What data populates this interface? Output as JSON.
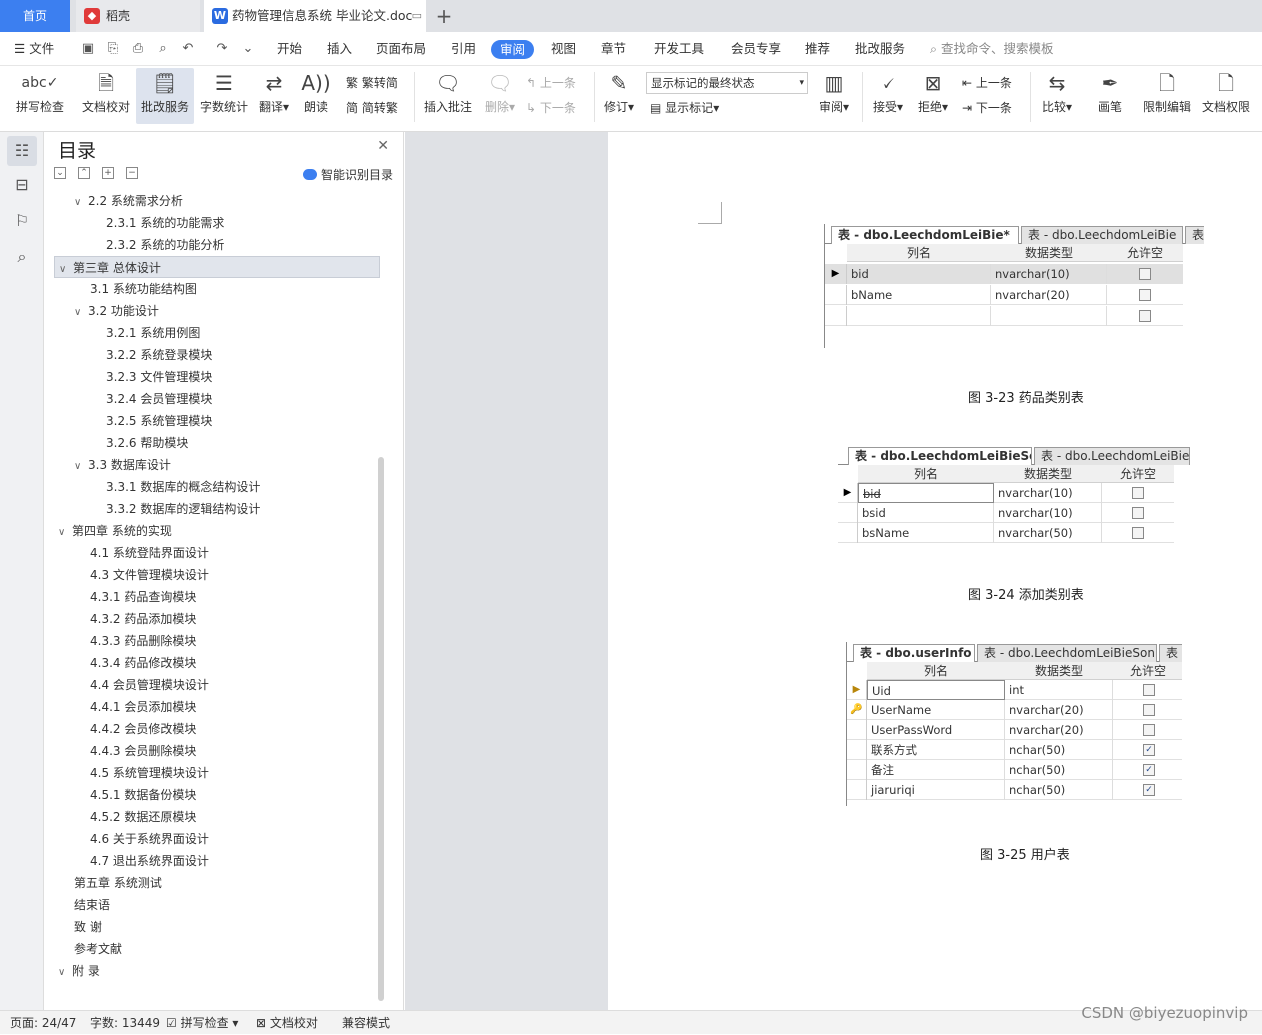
{
  "tabs": {
    "home": "首页",
    "daoke": "稻壳",
    "doc": "药物管理信息系统 毕业论文.doc"
  },
  "menu": {
    "file": "文件",
    "items": [
      "开始",
      "插入",
      "页面布局",
      "引用",
      "审阅",
      "视图",
      "章节",
      "开发工具",
      "会员专享",
      "推荐",
      "批改服务"
    ],
    "search": "查找命令、搜索模板"
  },
  "ribbon": {
    "spell": "拼写检查",
    "proof": "文档校对",
    "correct": "批改服务",
    "count": "字数统计",
    "translate": "翻译",
    "read": "朗读",
    "trad": "繁转简",
    "simp": "简转繁",
    "insert_comment": "插入批注",
    "delete": "删除",
    "prev_comment": "上一条",
    "next_comment": "下一条",
    "revise": "修订",
    "mark_state": "显示标记的最终状态",
    "show_marks": "显示标记",
    "review": "审阅",
    "accept": "接受",
    "reject": "拒绝",
    "prev": "上一条",
    "next": "下一条",
    "compare": "比较",
    "pen": "画笔",
    "restrict": "限制编辑",
    "rights": "文档权限"
  },
  "toc": {
    "title": "目录",
    "smart": "智能识别目录",
    "items": [
      "2.2  系统需求分析",
      "2.3.1  系统的功能需求",
      "2.3.2  系统的功能分析",
      "第三章  总体设计",
      "3.1  系统功能结构图",
      "3.2  功能设计",
      "3.2.1  系统用例图",
      "3.2.2  系统登录模块",
      "3.2.3  文件管理模块",
      "3.2.4  会员管理模块",
      "3.2.5  系统管理模块",
      "3.2.6  帮助模块",
      "3.3  数据库设计",
      "3.3.1  数据库的概念结构设计",
      "3.3.2  数据库的逻辑结构设计",
      "第四章  系统的实现",
      "4.1  系统登陆界面设计",
      "4.3  文件管理模块设计",
      "4.3.1 药品查询模块",
      "4.3.2  药品添加模块",
      "4.3.3 药品删除模块",
      "4.3.4 药品修改模块",
      "4.4 会员管理模块设计",
      "4.4.1 会员添加模块",
      "4.4.2 会员修改模块",
      "4.4.3 会员删除模块",
      "4.5  系统管理模块设计",
      "4.5.1  数据备份模块",
      "4.5.2  数据还原模块",
      "4.6  关于系统界面设计",
      "4.7  退出系统界面设计",
      "第五章  系统测试",
      "结束语",
      "致    谢",
      "参考文献",
      "附    录"
    ]
  },
  "tables": [
    {
      "tabs": [
        "表 - dbo.LeechdomLeiBie*",
        "表 - dbo.LeechdomLeiBie",
        "表"
      ],
      "headers": [
        "列名",
        "数据类型",
        "允许空"
      ],
      "rows": [
        [
          "bid",
          "nvarchar(10)"
        ],
        [
          "bName",
          "nvarchar(20)"
        ],
        [
          "",
          ""
        ]
      ],
      "allow_null": [
        false,
        false,
        false
      ],
      "caption": "图 3-23 药品类别表"
    },
    {
      "tabs": [
        "表 - dbo.LeechdomLeiBieSon",
        "表 - dbo.LeechdomLeiBie*"
      ],
      "headers": [
        "列名",
        "数据类型",
        "允许空"
      ],
      "rows": [
        [
          "bid",
          "nvarchar(10)"
        ],
        [
          "bsid",
          "nvarchar(10)"
        ],
        [
          "bsName",
          "nvarchar(50)"
        ]
      ],
      "allow_null": [
        false,
        false,
        false
      ],
      "caption": "图 3-24 添加类别表"
    },
    {
      "tabs": [
        "表 - dbo.userInfo",
        "表 - dbo.LeechdomLeiBieSon",
        "表"
      ],
      "headers": [
        "列名",
        "数据类型",
        "允许空"
      ],
      "rows": [
        [
          "Uid",
          "int"
        ],
        [
          "UserName",
          "nvarchar(20)"
        ],
        [
          "UserPassWord",
          "nvarchar(20)"
        ],
        [
          "联系方式",
          "nchar(50)"
        ],
        [
          "备注",
          "nchar(50)"
        ],
        [
          "jiaruriqi",
          "nchar(50)"
        ]
      ],
      "allow_null": [
        false,
        false,
        false,
        true,
        true,
        true
      ],
      "caption": "图 3-25  用户表"
    }
  ],
  "status": {
    "page": "页面: 24/47",
    "words": "字数: 13449",
    "spell": "拼写检查",
    "proof": "文档校对",
    "compat": "兼容模式"
  },
  "watermark": "CSDN @biyezuopinvip"
}
